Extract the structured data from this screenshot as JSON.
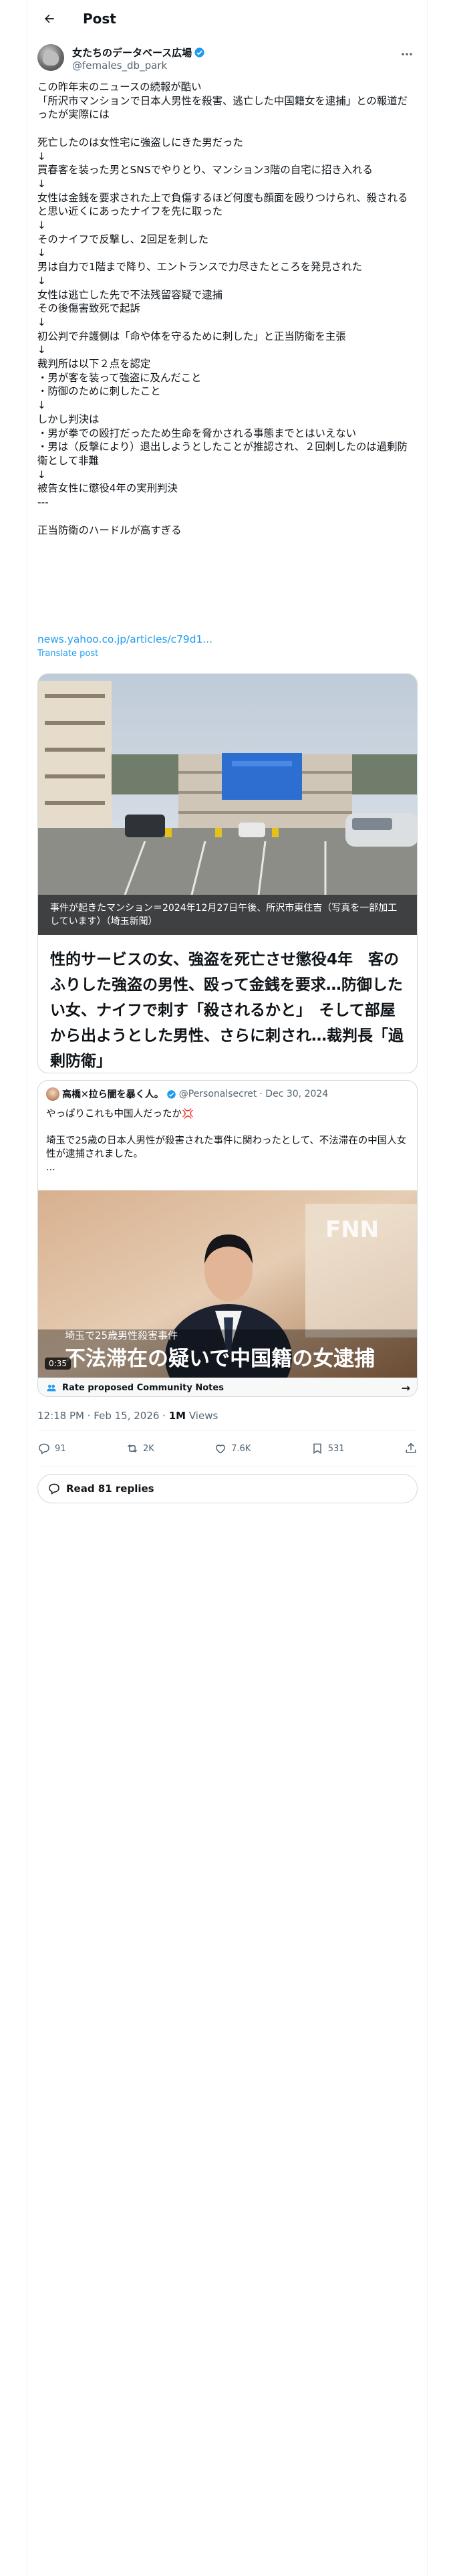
{
  "header": {
    "title": "Post"
  },
  "author": {
    "name": "女たちのデータベース広場",
    "handle": "@females_db_park"
  },
  "post": {
    "text": "この昨年末のニュースの続報が酷い\n「所沢市マンションで日本人男性を殺害、逃亡した中国籍女を逮捕」との報道だったが実際には\n\n死亡したのは女性宅に強盗しにきた男だった\n↓\n買春客を装った男とSNSでやりとり、マンション3階の自宅に招き入れる\n↓\n女性は金銭を要求された上で負傷するほど何度も顔面を殴りつけられ、殺されると思い近くにあったナイフを先に取った\n↓\nそのナイフで反撃し、2回足を刺した\n↓\n男は自力で1階まで降り、エントランスで力尽きたところを発見された\n↓\n女性は逃亡した先で不法残留容疑で逮捕\nその後傷害致死で起訴\n↓\n初公判で弁護側は「命や体を守るために刺した」と正当防衛を主張\n↓\n裁判所は以下２点を認定\n・男が客を装って強盗に及んだこと\n・防御のために刺したこと\n↓\nしかし判決は\n・男が拳での殴打だったため生命を脅かされる事態までとはいえない\n・男は（反撃により）退出しようとしたことが推認され、２回刺したのは過剰防衛として非難\n↓\n被告女性に懲役4年の実刑判決\n---\n\n正当防衛のハードルが高すぎる",
    "link": "news.yahoo.co.jp/articles/c79d1...",
    "translate": "Translate post",
    "timestamp": "12:18 PM · Feb 15, 2026 · ",
    "views_count": "1M",
    "views_label": " Views"
  },
  "card": {
    "caption": "事件が起きたマンション＝2024年12月27日午後、所沢市東住吉（写真を一部加工しています）（埼玉新聞）",
    "title": "性的サービスの女、強盗を死亡させ懲役4年　客のふりした強盗の男性、殴って金銭を要求…防御したい女、ナイフで刺す「殺されるかと」　そして部屋から出ようとした男性、さらに刺され…裁判長「過剰防衛」"
  },
  "quote": {
    "name": "高橋✕拉ら闇を暴く人。",
    "handle": "@Personalsecret",
    "date": "· Dec 30, 2024",
    "text": "やっぱりこれも中国人だったか💢\n\n埼玉で25歳の日本人男性が殺害された事件に関わったとして、不法滞在の中国人女性が逮捕されました。\n...",
    "video_caption_small": "埼玉で25歳男性殺害事件",
    "video_caption_big": "不法滞在の疑いで中国籍の女逮捕",
    "video_logo": "FNN",
    "video_time": "0:35",
    "notes": "Rate proposed Community Notes"
  },
  "actions": {
    "replies": "91",
    "reposts": "2K",
    "likes": "7.6K",
    "bookmarks": "531"
  },
  "read_replies": "Read 81 replies",
  "colors": {
    "accent": "#1d9bf0",
    "muted": "#536471",
    "border": "#cfd9de",
    "verified": "#1d9bf0"
  },
  "icons": [
    "back-arrow-icon",
    "verified-badge-icon",
    "more-icon",
    "reply-icon",
    "repost-icon",
    "like-icon",
    "bookmark-icon",
    "share-icon",
    "notes-icon",
    "chat-bubble-icon"
  ]
}
